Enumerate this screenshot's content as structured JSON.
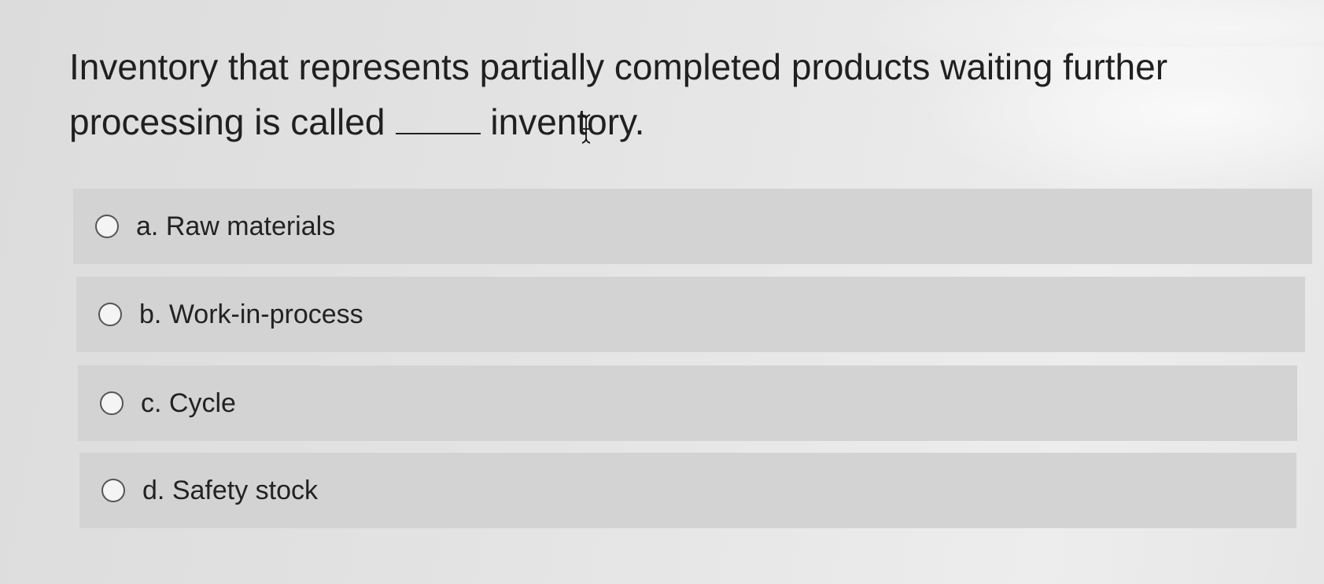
{
  "question": {
    "part1": "Inventory that represents partially completed products waiting further processing is called",
    "part2": "inventory."
  },
  "options": [
    {
      "letter": "a.",
      "label": "Raw materials"
    },
    {
      "letter": "b.",
      "label": "Work-in-process"
    },
    {
      "letter": "c.",
      "label": "Cycle"
    },
    {
      "letter": "d.",
      "label": "Safety stock"
    }
  ],
  "cursor": {
    "icon": "text-ibeam-cursor-icon"
  },
  "colors": {
    "background": "#e2e2e2",
    "option_background": "#d3d3d3",
    "text": "#202020",
    "radio_border": "#555555"
  }
}
